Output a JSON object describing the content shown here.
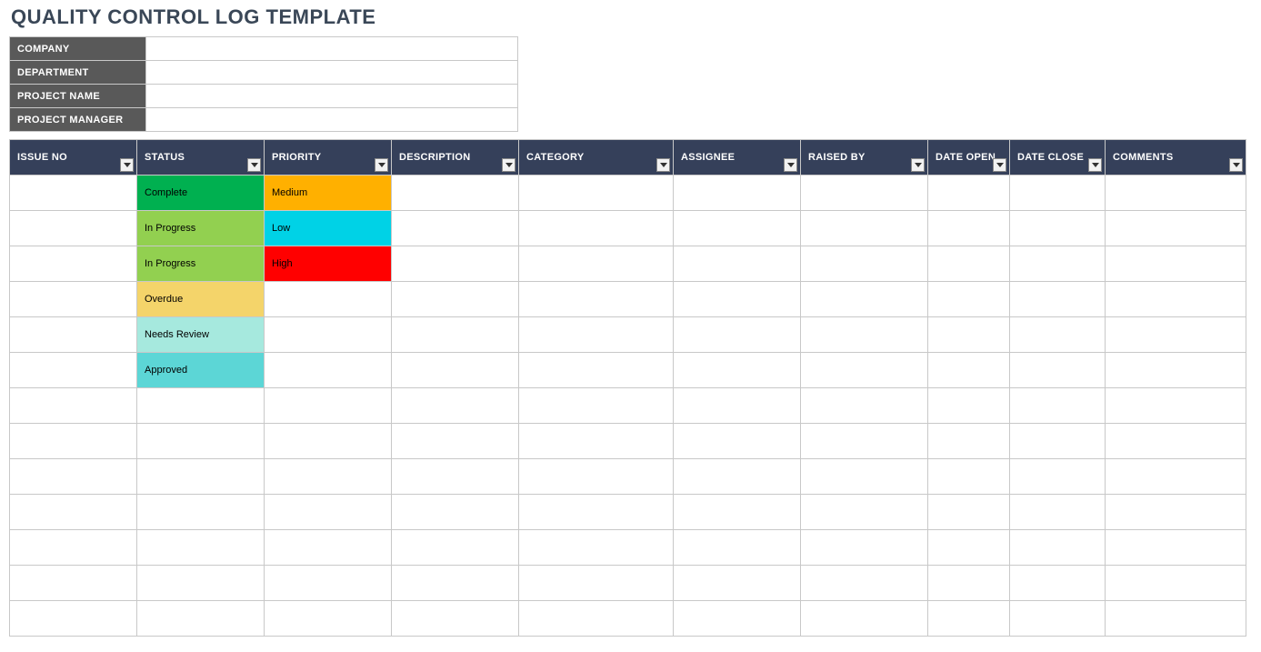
{
  "title": "QUALITY CONTROL LOG TEMPLATE",
  "info": {
    "labels": {
      "company": "COMPANY",
      "department": "DEPARTMENT",
      "project_name": "PROJECT NAME",
      "project_manager": "PROJECT MANAGER"
    },
    "values": {
      "company": "",
      "department": "",
      "project_name": "",
      "project_manager": ""
    }
  },
  "columns": {
    "issue_no": "ISSUE NO",
    "status": "STATUS",
    "priority": "PRIORITY",
    "description": "DESCRIPTION",
    "category": "CATEGORY",
    "assignee": "ASSIGNEE",
    "raised_by": "RAISED BY",
    "date_open": "DATE OPEN",
    "date_close": "DATE CLOSE",
    "comments": "COMMENTS"
  },
  "status_colors": {
    "Complete": "#00B050",
    "In Progress": "#92D050",
    "Overdue": "#F4D46A",
    "Needs Review": "#A6E9DE",
    "Approved": "#5CD6D6"
  },
  "priority_colors": {
    "Medium": "#FFB000",
    "Low": "#00D2E6",
    "High": "#FF0000"
  },
  "rows": [
    {
      "issue_no": "",
      "status": "Complete",
      "priority": "Medium",
      "description": "",
      "category": "",
      "assignee": "",
      "raised_by": "",
      "date_open": "",
      "date_close": "",
      "comments": ""
    },
    {
      "issue_no": "",
      "status": "In Progress",
      "priority": "Low",
      "description": "",
      "category": "",
      "assignee": "",
      "raised_by": "",
      "date_open": "",
      "date_close": "",
      "comments": ""
    },
    {
      "issue_no": "",
      "status": "In Progress",
      "priority": "High",
      "description": "",
      "category": "",
      "assignee": "",
      "raised_by": "",
      "date_open": "",
      "date_close": "",
      "comments": ""
    },
    {
      "issue_no": "",
      "status": "Overdue",
      "priority": "",
      "description": "",
      "category": "",
      "assignee": "",
      "raised_by": "",
      "date_open": "",
      "date_close": "",
      "comments": ""
    },
    {
      "issue_no": "",
      "status": "Needs Review",
      "priority": "",
      "description": "",
      "category": "",
      "assignee": "",
      "raised_by": "",
      "date_open": "",
      "date_close": "",
      "comments": ""
    },
    {
      "issue_no": "",
      "status": "Approved",
      "priority": "",
      "description": "",
      "category": "",
      "assignee": "",
      "raised_by": "",
      "date_open": "",
      "date_close": "",
      "comments": ""
    },
    {
      "issue_no": "",
      "status": "",
      "priority": "",
      "description": "",
      "category": "",
      "assignee": "",
      "raised_by": "",
      "date_open": "",
      "date_close": "",
      "comments": ""
    },
    {
      "issue_no": "",
      "status": "",
      "priority": "",
      "description": "",
      "category": "",
      "assignee": "",
      "raised_by": "",
      "date_open": "",
      "date_close": "",
      "comments": ""
    },
    {
      "issue_no": "",
      "status": "",
      "priority": "",
      "description": "",
      "category": "",
      "assignee": "",
      "raised_by": "",
      "date_open": "",
      "date_close": "",
      "comments": ""
    },
    {
      "issue_no": "",
      "status": "",
      "priority": "",
      "description": "",
      "category": "",
      "assignee": "",
      "raised_by": "",
      "date_open": "",
      "date_close": "",
      "comments": ""
    },
    {
      "issue_no": "",
      "status": "",
      "priority": "",
      "description": "",
      "category": "",
      "assignee": "",
      "raised_by": "",
      "date_open": "",
      "date_close": "",
      "comments": ""
    },
    {
      "issue_no": "",
      "status": "",
      "priority": "",
      "description": "",
      "category": "",
      "assignee": "",
      "raised_by": "",
      "date_open": "",
      "date_close": "",
      "comments": ""
    },
    {
      "issue_no": "",
      "status": "",
      "priority": "",
      "description": "",
      "category": "",
      "assignee": "",
      "raised_by": "",
      "date_open": "",
      "date_close": "",
      "comments": ""
    }
  ]
}
